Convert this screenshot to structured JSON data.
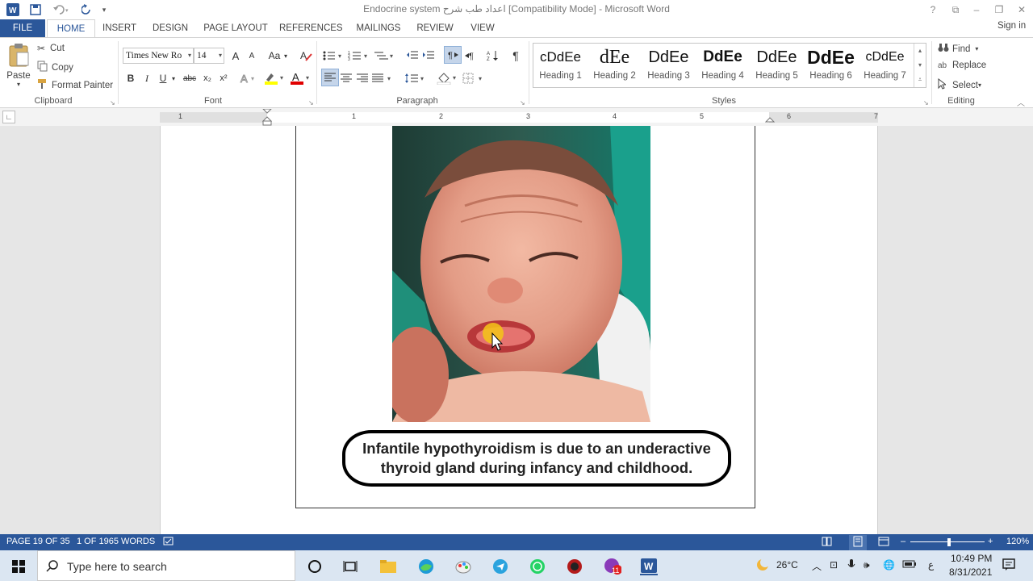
{
  "window": {
    "title": "Endocrine system اعداد طب شرح [Compatibility Mode] - Microsoft Word",
    "help": "?",
    "controls": [
      "?",
      "⧉",
      "–",
      "❐",
      "✕"
    ]
  },
  "tabs": [
    "FILE",
    "HOME",
    "INSERT",
    "DESIGN",
    "PAGE LAYOUT",
    "REFERENCES",
    "MAILINGS",
    "REVIEW",
    "VIEW"
  ],
  "signin": "Sign in",
  "clipboard": {
    "paste": "Paste",
    "cut": "Cut",
    "copy": "Copy",
    "format_painter": "Format Painter",
    "label": "Clipboard"
  },
  "font": {
    "name": "Times New Ro",
    "size": "14",
    "label": "Font",
    "bold": "B",
    "italic": "I",
    "underline": "U",
    "strike": "abc",
    "subscript": "x₂",
    "superscript": "x²",
    "grow": "A",
    "shrink": "A",
    "case": "Aa"
  },
  "paragraph": {
    "label": "Paragraph",
    "pilcrow": "¶"
  },
  "styles": {
    "label": "Styles",
    "items": [
      {
        "sample": "cDdEe",
        "name": "Heading 1"
      },
      {
        "sample": "dEe",
        "name": "Heading 2"
      },
      {
        "sample": "DdEe",
        "name": "Heading 3"
      },
      {
        "sample": "DdEe",
        "name": "Heading 4"
      },
      {
        "sample": "DdEe",
        "name": "Heading 5"
      },
      {
        "sample": "DdEe",
        "name": "Heading 6"
      },
      {
        "sample": "cDdEe",
        "name": "Heading 7"
      }
    ]
  },
  "editing": {
    "find": "Find",
    "replace": "Replace",
    "select": "Select",
    "label": "Editing"
  },
  "ruler": {
    "numbers": [
      "1",
      "1",
      "2",
      "3",
      "4",
      "5",
      "6",
      "7"
    ]
  },
  "document": {
    "caption": "Infantile hypothyroidism is due to an underactive thyroid gland during infancy and childhood."
  },
  "status": {
    "page": "PAGE 19 OF 35",
    "words": "1 OF 1965 WORDS",
    "zoom": "120%",
    "zoom_minus": "–",
    "zoom_plus": "+"
  },
  "taskbar": {
    "search_placeholder": "Type here to search",
    "weather": "26°C",
    "lang": "ع",
    "time": "10:49 PM",
    "date": "8/31/2021",
    "badge": "11"
  },
  "colors": {
    "word_blue": "#2b579a",
    "highlight": "#ffff00",
    "font_color": "#e00000"
  }
}
